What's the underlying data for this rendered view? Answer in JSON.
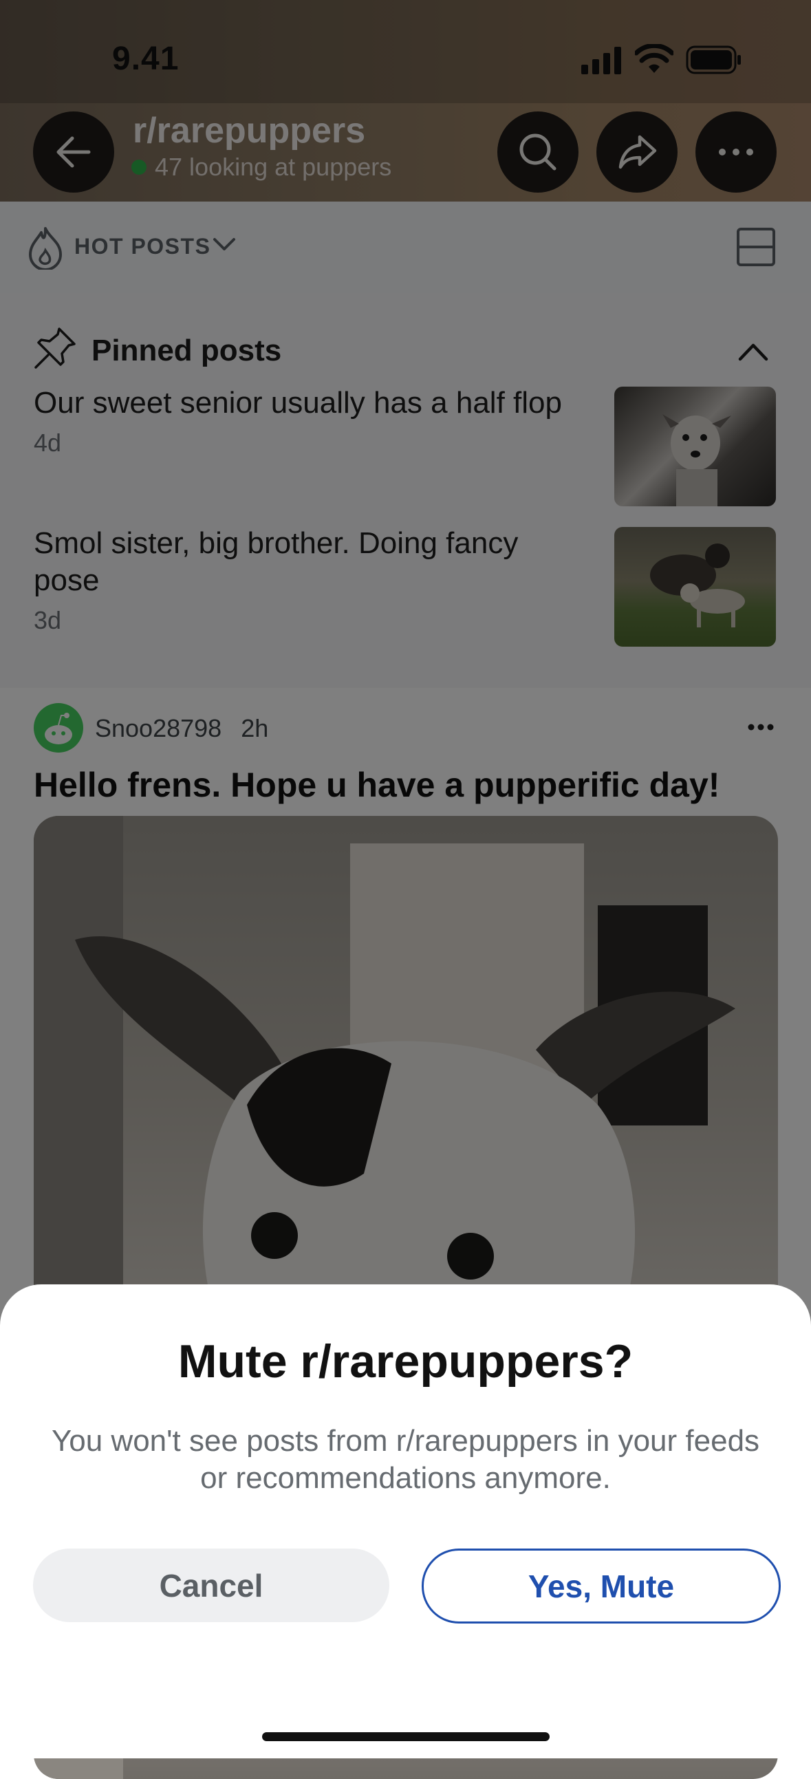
{
  "status_bar": {
    "time": "9.41"
  },
  "header": {
    "subreddit": "r/rarepuppers",
    "online_text": "47 looking at puppers"
  },
  "sort": {
    "label": "HOT POSTS"
  },
  "pinned": {
    "title": "Pinned posts",
    "items": [
      {
        "title": "Our sweet senior usually has a half flop",
        "age": "4d"
      },
      {
        "title": "Smol sister, big brother. Doing fancy pose",
        "age": "3d"
      }
    ]
  },
  "post": {
    "author": "Snoo28798",
    "age": "2h",
    "title": "Hello frens. Hope u have a pupperific day!"
  },
  "dialog": {
    "title": "Mute r/rarepuppers?",
    "message": "You won't see posts from r/rarepuppers in your feeds or recommendations anymore.",
    "cancel_label": "Cancel",
    "confirm_label": "Yes, Mute"
  },
  "colors": {
    "accent": "#1f4fae",
    "online_dot": "#2fb24b",
    "overlay": "rgba(0,0,0,0.5)"
  },
  "icons": [
    "back-arrow-icon",
    "search-icon",
    "share-icon",
    "more-icon",
    "flame-icon",
    "chevron-down-icon",
    "layout-icon",
    "pin-icon",
    "chevron-up-icon",
    "snoo-avatar-icon",
    "signal-icon",
    "wifi-icon",
    "battery-icon"
  ]
}
